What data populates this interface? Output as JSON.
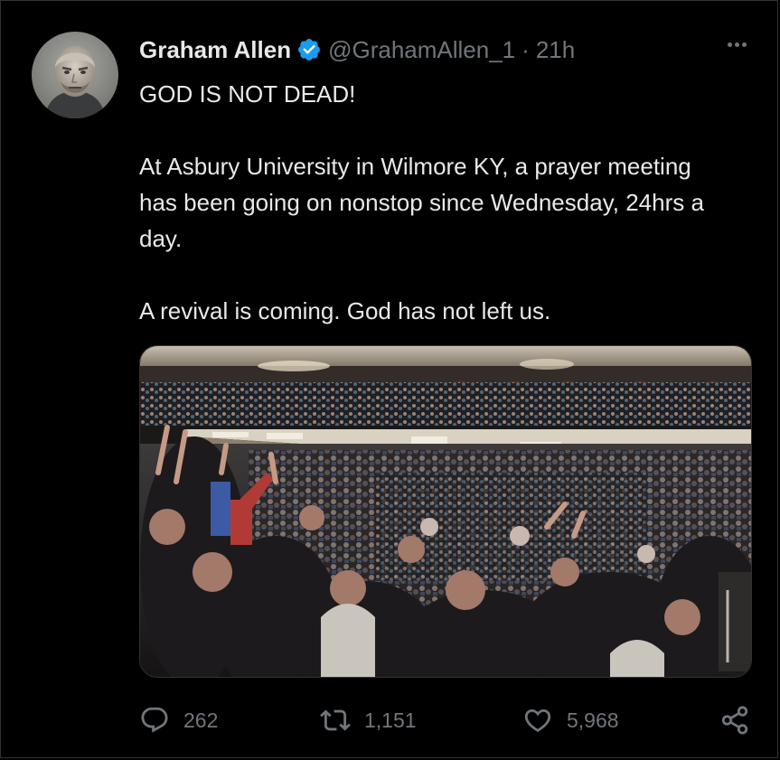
{
  "author": {
    "display_name": "Graham Allen",
    "handle": "@GrahamAllen_1",
    "time": "21h",
    "verified_color": "#1d9bf0"
  },
  "text": {
    "line1": "GOD IS NOT DEAD!",
    "paragraph2": "At Asbury University in Wilmore KY, a prayer meeting has been going on nonstop since Wednesday, 24hrs a day.",
    "paragraph3": "A revival is coming. God has not left us."
  },
  "actions": {
    "replies": "262",
    "retweets": "1,151",
    "likes": "5,968"
  },
  "icons": {
    "more": "more-horizontal-icon",
    "reply": "reply-bubble-icon",
    "retweet": "retweet-icon",
    "like": "heart-icon",
    "share": "share-icon"
  }
}
